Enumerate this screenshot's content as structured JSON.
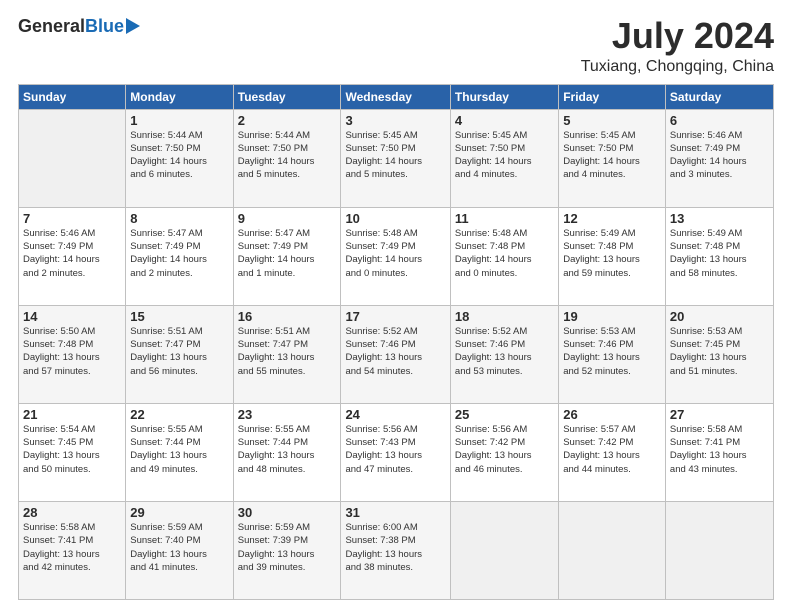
{
  "header": {
    "logo_general": "General",
    "logo_blue": "Blue",
    "main_title": "July 2024",
    "subtitle": "Tuxiang, Chongqing, China"
  },
  "calendar": {
    "days_of_week": [
      "Sunday",
      "Monday",
      "Tuesday",
      "Wednesday",
      "Thursday",
      "Friday",
      "Saturday"
    ],
    "weeks": [
      [
        {
          "day": "",
          "info": ""
        },
        {
          "day": "1",
          "info": "Sunrise: 5:44 AM\nSunset: 7:50 PM\nDaylight: 14 hours\nand 6 minutes."
        },
        {
          "day": "2",
          "info": "Sunrise: 5:44 AM\nSunset: 7:50 PM\nDaylight: 14 hours\nand 5 minutes."
        },
        {
          "day": "3",
          "info": "Sunrise: 5:45 AM\nSunset: 7:50 PM\nDaylight: 14 hours\nand 5 minutes."
        },
        {
          "day": "4",
          "info": "Sunrise: 5:45 AM\nSunset: 7:50 PM\nDaylight: 14 hours\nand 4 minutes."
        },
        {
          "day": "5",
          "info": "Sunrise: 5:45 AM\nSunset: 7:50 PM\nDaylight: 14 hours\nand 4 minutes."
        },
        {
          "day": "6",
          "info": "Sunrise: 5:46 AM\nSunset: 7:49 PM\nDaylight: 14 hours\nand 3 minutes."
        }
      ],
      [
        {
          "day": "7",
          "info": "Sunrise: 5:46 AM\nSunset: 7:49 PM\nDaylight: 14 hours\nand 2 minutes."
        },
        {
          "day": "8",
          "info": "Sunrise: 5:47 AM\nSunset: 7:49 PM\nDaylight: 14 hours\nand 2 minutes."
        },
        {
          "day": "9",
          "info": "Sunrise: 5:47 AM\nSunset: 7:49 PM\nDaylight: 14 hours\nand 1 minute."
        },
        {
          "day": "10",
          "info": "Sunrise: 5:48 AM\nSunset: 7:49 PM\nDaylight: 14 hours\nand 0 minutes."
        },
        {
          "day": "11",
          "info": "Sunrise: 5:48 AM\nSunset: 7:48 PM\nDaylight: 14 hours\nand 0 minutes."
        },
        {
          "day": "12",
          "info": "Sunrise: 5:49 AM\nSunset: 7:48 PM\nDaylight: 13 hours\nand 59 minutes."
        },
        {
          "day": "13",
          "info": "Sunrise: 5:49 AM\nSunset: 7:48 PM\nDaylight: 13 hours\nand 58 minutes."
        }
      ],
      [
        {
          "day": "14",
          "info": "Sunrise: 5:50 AM\nSunset: 7:48 PM\nDaylight: 13 hours\nand 57 minutes."
        },
        {
          "day": "15",
          "info": "Sunrise: 5:51 AM\nSunset: 7:47 PM\nDaylight: 13 hours\nand 56 minutes."
        },
        {
          "day": "16",
          "info": "Sunrise: 5:51 AM\nSunset: 7:47 PM\nDaylight: 13 hours\nand 55 minutes."
        },
        {
          "day": "17",
          "info": "Sunrise: 5:52 AM\nSunset: 7:46 PM\nDaylight: 13 hours\nand 54 minutes."
        },
        {
          "day": "18",
          "info": "Sunrise: 5:52 AM\nSunset: 7:46 PM\nDaylight: 13 hours\nand 53 minutes."
        },
        {
          "day": "19",
          "info": "Sunrise: 5:53 AM\nSunset: 7:46 PM\nDaylight: 13 hours\nand 52 minutes."
        },
        {
          "day": "20",
          "info": "Sunrise: 5:53 AM\nSunset: 7:45 PM\nDaylight: 13 hours\nand 51 minutes."
        }
      ],
      [
        {
          "day": "21",
          "info": "Sunrise: 5:54 AM\nSunset: 7:45 PM\nDaylight: 13 hours\nand 50 minutes."
        },
        {
          "day": "22",
          "info": "Sunrise: 5:55 AM\nSunset: 7:44 PM\nDaylight: 13 hours\nand 49 minutes."
        },
        {
          "day": "23",
          "info": "Sunrise: 5:55 AM\nSunset: 7:44 PM\nDaylight: 13 hours\nand 48 minutes."
        },
        {
          "day": "24",
          "info": "Sunrise: 5:56 AM\nSunset: 7:43 PM\nDaylight: 13 hours\nand 47 minutes."
        },
        {
          "day": "25",
          "info": "Sunrise: 5:56 AM\nSunset: 7:42 PM\nDaylight: 13 hours\nand 46 minutes."
        },
        {
          "day": "26",
          "info": "Sunrise: 5:57 AM\nSunset: 7:42 PM\nDaylight: 13 hours\nand 44 minutes."
        },
        {
          "day": "27",
          "info": "Sunrise: 5:58 AM\nSunset: 7:41 PM\nDaylight: 13 hours\nand 43 minutes."
        }
      ],
      [
        {
          "day": "28",
          "info": "Sunrise: 5:58 AM\nSunset: 7:41 PM\nDaylight: 13 hours\nand 42 minutes."
        },
        {
          "day": "29",
          "info": "Sunrise: 5:59 AM\nSunset: 7:40 PM\nDaylight: 13 hours\nand 41 minutes."
        },
        {
          "day": "30",
          "info": "Sunrise: 5:59 AM\nSunset: 7:39 PM\nDaylight: 13 hours\nand 39 minutes."
        },
        {
          "day": "31",
          "info": "Sunrise: 6:00 AM\nSunset: 7:38 PM\nDaylight: 13 hours\nand 38 minutes."
        },
        {
          "day": "",
          "info": ""
        },
        {
          "day": "",
          "info": ""
        },
        {
          "day": "",
          "info": ""
        }
      ]
    ]
  }
}
